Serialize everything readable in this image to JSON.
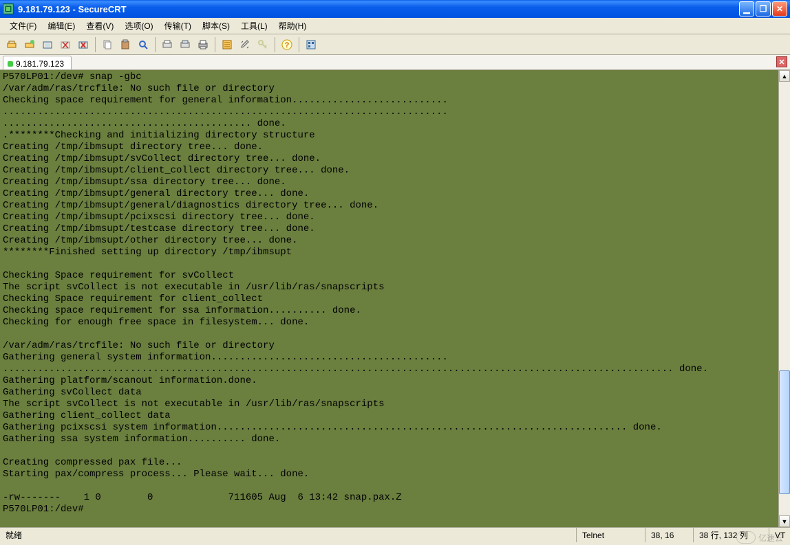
{
  "window": {
    "title": "9.181.79.123 - SecureCRT"
  },
  "menu": {
    "file": "文件(F)",
    "edit": "编辑(E)",
    "view": "查看(V)",
    "options": "选项(O)",
    "transfer": "传输(T)",
    "script": "脚本(S)",
    "tools": "工具(L)",
    "help": "帮助(H)"
  },
  "tab": {
    "label": "9.181.79.123"
  },
  "terminal": {
    "lines": [
      "P570LP01:/dev# snap -gbc",
      "/var/adm/ras/trcfile: No such file or directory",
      "Checking space requirement for general information...........................",
      ".............................................................................",
      "........................................... done.",
      ".********Checking and initializing directory structure",
      "Creating /tmp/ibmsupt directory tree... done.",
      "Creating /tmp/ibmsupt/svCollect directory tree... done.",
      "Creating /tmp/ibmsupt/client_collect directory tree... done.",
      "Creating /tmp/ibmsupt/ssa directory tree... done.",
      "Creating /tmp/ibmsupt/general directory tree... done.",
      "Creating /tmp/ibmsupt/general/diagnostics directory tree... done.",
      "Creating /tmp/ibmsupt/pcixscsi directory tree... done.",
      "Creating /tmp/ibmsupt/testcase directory tree... done.",
      "Creating /tmp/ibmsupt/other directory tree... done.",
      "********Finished setting up directory /tmp/ibmsupt",
      "",
      "Checking Space requirement for svCollect",
      "The script svCollect is not executable in /usr/lib/ras/snapscripts",
      "Checking Space requirement for client_collect",
      "Checking space requirement for ssa information.......... done.",
      "Checking for enough free space in filesystem... done.",
      "",
      "/var/adm/ras/trcfile: No such file or directory",
      "Gathering general system information.........................................",
      ".................................................................................................................... done.",
      "Gathering platform/scanout information.done.",
      "Gathering svCollect data",
      "The script svCollect is not executable in /usr/lib/ras/snapscripts",
      "Gathering client_collect data",
      "Gathering pcixscsi system information....................................................................... done.",
      "Gathering ssa system information.......... done.",
      "",
      "Creating compressed pax file...",
      "Starting pax/compress process... Please wait... done.",
      "",
      "-rw-------    1 0        0             711605 Aug  6 13:42 snap.pax.Z",
      "P570LP01:/dev#"
    ]
  },
  "status": {
    "ready": "就绪",
    "protocol": "Telnet",
    "cursor": "38, 16",
    "size": "38 行, 132 列",
    "mode": "VT"
  },
  "watermark": "亿速云"
}
